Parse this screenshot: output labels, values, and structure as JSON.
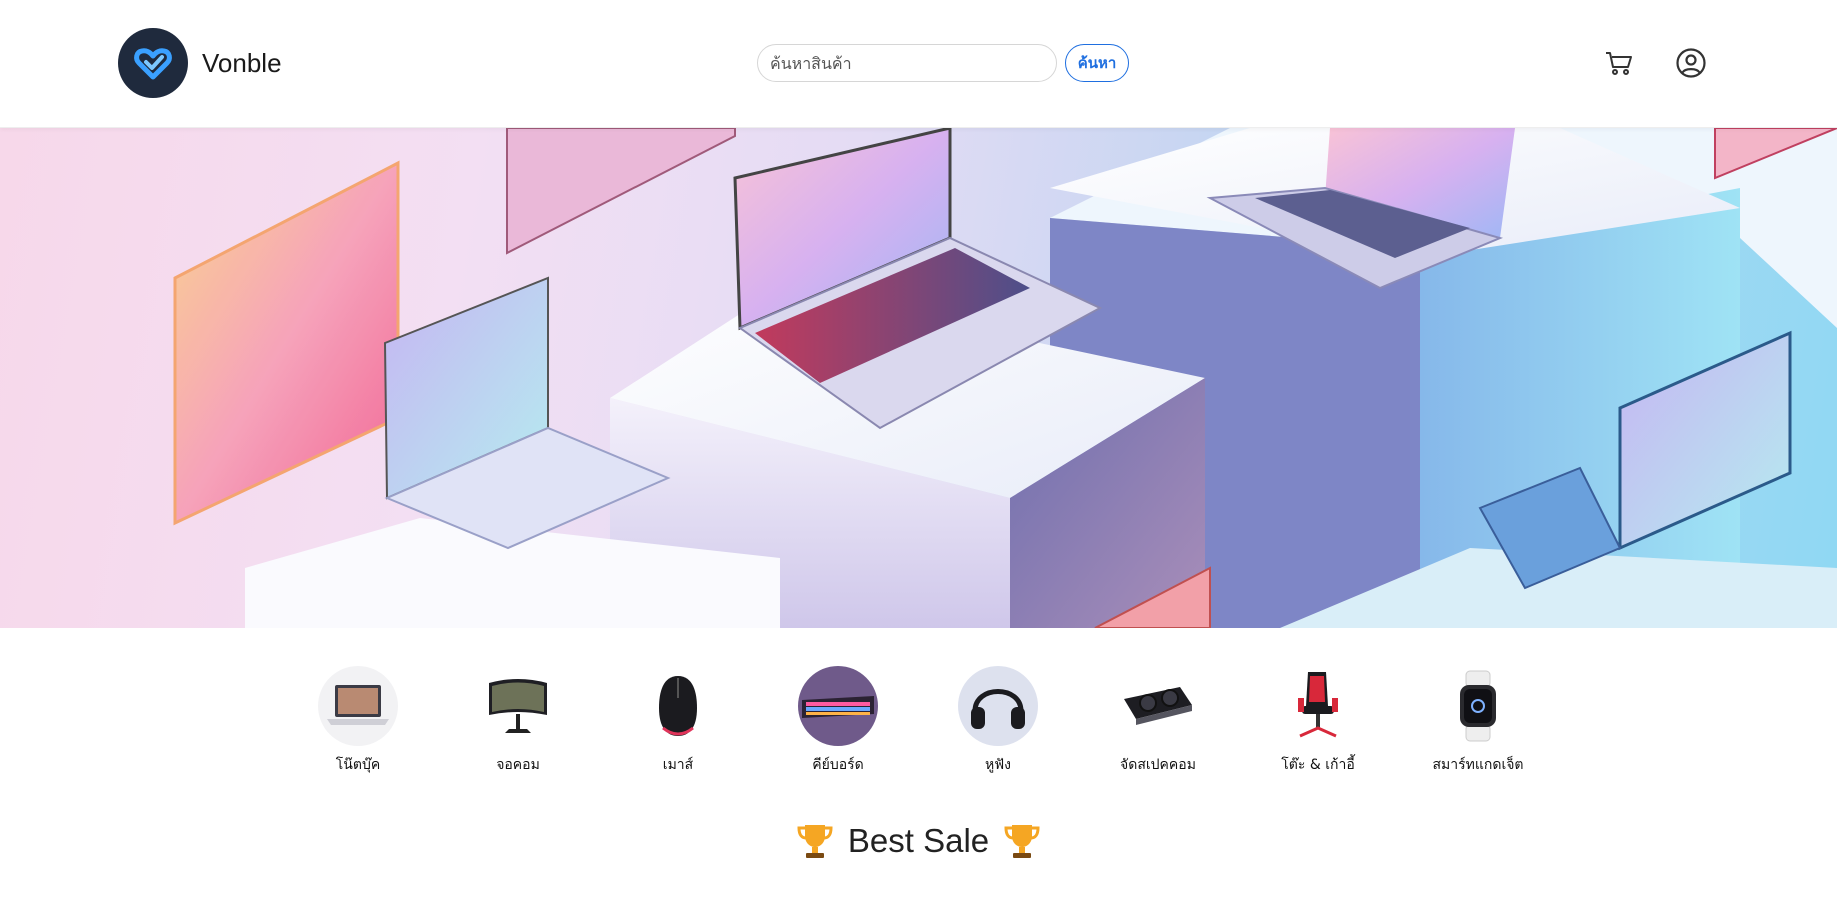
{
  "header": {
    "brand": "Vonble",
    "search": {
      "placeholder": "ค้นหาสินค้า",
      "value": ""
    },
    "search_button_label": "ค้นหา",
    "icons": [
      "cart-icon",
      "user-icon"
    ]
  },
  "hero": {
    "image": "banner-laptops-on-pedestals"
  },
  "categories": [
    {
      "label": "โน๊ตบุ๊ค",
      "icon": "laptop"
    },
    {
      "label": "จอคอม",
      "icon": "monitor"
    },
    {
      "label": "เมาส์",
      "icon": "mouse"
    },
    {
      "label": "คีย์บอร์ด",
      "icon": "keyboard"
    },
    {
      "label": "หูฟัง",
      "icon": "headphones"
    },
    {
      "label": "จัดสเปคคอม",
      "icon": "graphics-card"
    },
    {
      "label": "โต๊ะ & เก้าอี้",
      "icon": "gaming-chair"
    },
    {
      "label": "สมาร์ทแกดเจ็ต",
      "icon": "smartwatch"
    }
  ],
  "best_sale": {
    "title": "Best Sale",
    "icon": "trophy-icon"
  },
  "colors": {
    "accent": "#1f6fe0",
    "logo_bg": "#1f2a3d",
    "logo_mark": "#3aa0ff"
  }
}
